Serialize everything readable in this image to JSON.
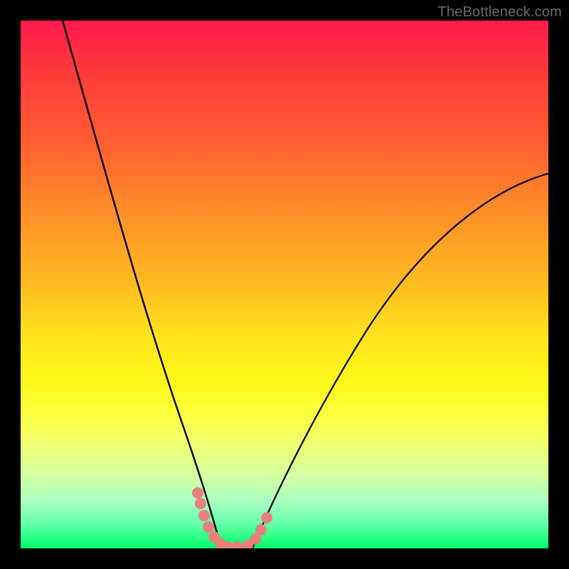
{
  "watermark": "TheBottleneck.com",
  "chart_data": {
    "type": "line",
    "title": "",
    "xlabel": "",
    "ylabel": "",
    "xlim": [
      0,
      100
    ],
    "ylim": [
      0,
      100
    ],
    "grid": false,
    "series": [
      {
        "name": "left-curve",
        "x": [
          8,
          10,
          12,
          14,
          16,
          18,
          20,
          22,
          24,
          26,
          28,
          30,
          32,
          34,
          35,
          36,
          37,
          38
        ],
        "y": [
          100,
          92,
          84,
          76,
          68,
          60,
          52,
          44,
          37,
          30,
          23,
          17,
          11,
          6,
          4,
          2.5,
          1,
          0
        ]
      },
      {
        "name": "right-curve",
        "x": [
          44,
          46,
          48,
          50,
          54,
          58,
          62,
          66,
          70,
          74,
          78,
          82,
          86,
          90,
          94,
          98,
          100
        ],
        "y": [
          0,
          2,
          4,
          6.5,
          12,
          18,
          24,
          30,
          36,
          42,
          48,
          53,
          58,
          62,
          66,
          69,
          71
        ]
      },
      {
        "name": "valley-floor",
        "x": [
          38,
          40,
          42,
          44
        ],
        "y": [
          0,
          0,
          0,
          0
        ]
      }
    ],
    "markers": {
      "name": "dotted-overlay",
      "color": "#e6817b",
      "points": [
        {
          "x": 33.5,
          "y": 10.5
        },
        {
          "x": 34.0,
          "y": 8.5
        },
        {
          "x": 34.7,
          "y": 6.2
        },
        {
          "x": 35.6,
          "y": 4.0
        },
        {
          "x": 36.6,
          "y": 2.2
        },
        {
          "x": 37.8,
          "y": 0.9
        },
        {
          "x": 39.2,
          "y": 0.3
        },
        {
          "x": 41.0,
          "y": 0.2
        },
        {
          "x": 43.0,
          "y": 0.6
        },
        {
          "x": 44.5,
          "y": 1.8
        },
        {
          "x": 45.6,
          "y": 3.5
        },
        {
          "x": 46.6,
          "y": 5.8
        }
      ]
    },
    "gradient_scale": {
      "top_color": "#ff1a4d",
      "mid_color": "#ffe41c",
      "bottom_color": "#00ff66"
    }
  }
}
